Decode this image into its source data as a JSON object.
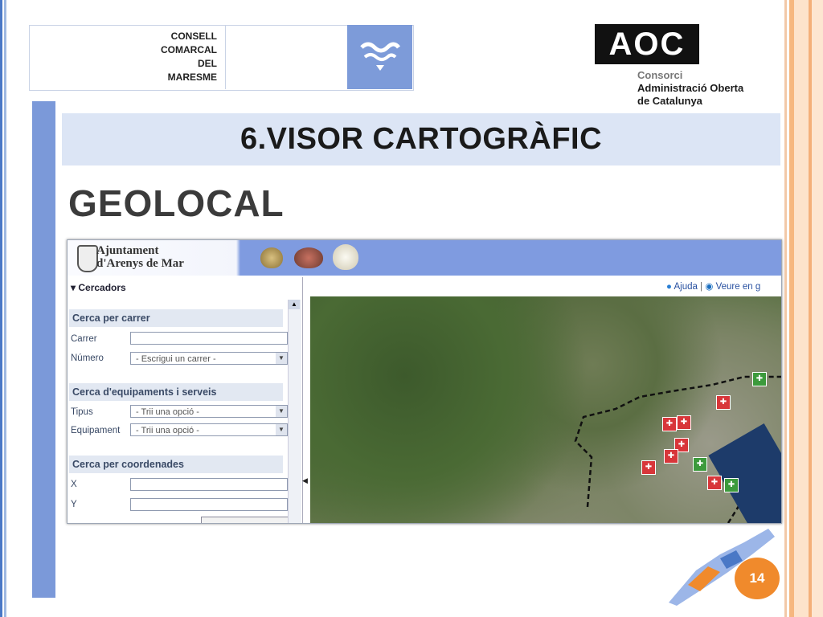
{
  "header": {
    "consell_logo": {
      "line1": "CONSELL",
      "line2": "COMARCAL",
      "line3": "DEL",
      "line4": "MARESME"
    },
    "aoc_logo": {
      "mark": "AOC",
      "line1": "Consorci",
      "line2": "Administració Oberta",
      "line3": "de Catalunya"
    }
  },
  "slide": {
    "title": "6.VISOR CARTOGRÀFIC",
    "brand": "GEOLOCAL",
    "page_number": "14"
  },
  "app": {
    "site_title_line1": "Ajuntament",
    "site_title_line2": "d'Arenys de Mar",
    "panel_title": "▾ Cercadors",
    "links": {
      "help": "Ajuda",
      "separator": "|",
      "view": "Veure en g"
    },
    "sections": [
      {
        "title": "Cerca per carrer"
      },
      {
        "title": "Cerca d'equipaments i serveis"
      },
      {
        "title": "Cerca per coordenades"
      }
    ],
    "fields": {
      "carrer_label": "Carrer",
      "numero_label": "Número",
      "numero_value": "- Escrigui un carrer -",
      "tipus_label": "Tipus",
      "tipus_value": "- Trii una opció -",
      "equipament_label": "Equipament",
      "equipament_value": "- Trii una opció -",
      "x_label": "X",
      "y_label": "Y"
    }
  },
  "colors": {
    "accent_blue": "#7b99d9",
    "title_band": "#dce5f5",
    "slide_number_bg": "#f08a2c",
    "marker_red": "#d8363a",
    "marker_green": "#3c9a3c"
  }
}
